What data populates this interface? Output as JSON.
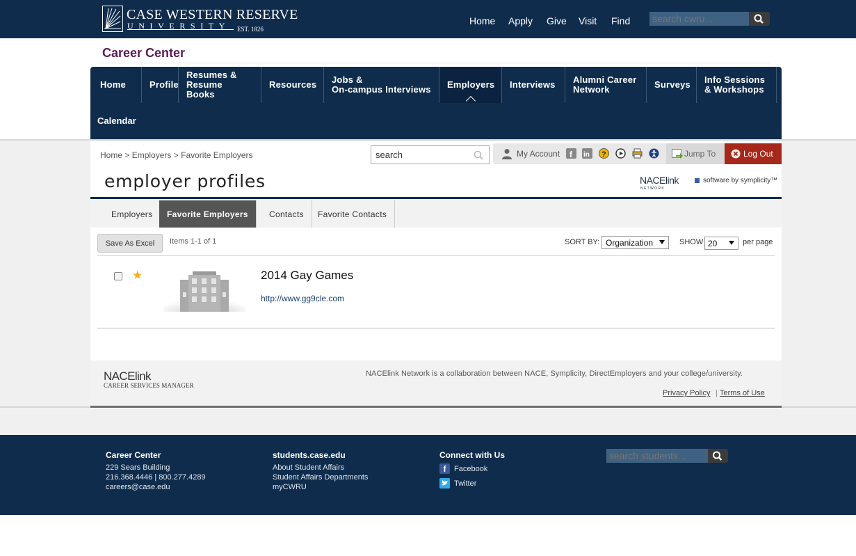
{
  "branding": {
    "university_line1": "CASE WESTERN RESERVE",
    "university_line2": "UNIVERSITY",
    "established": "EST. 1826"
  },
  "top_nav": {
    "items": [
      "Home",
      "Apply",
      "Give",
      "Visit",
      "Find"
    ],
    "search_placeholder": "search cwru..."
  },
  "site_title": "Career Center",
  "main_nav": {
    "items": [
      {
        "label": "Home"
      },
      {
        "label": "Profile"
      },
      {
        "label": "Resumes &\nResume Books"
      },
      {
        "label": "Resources"
      },
      {
        "label": "Jobs &\nOn-campus Interviews"
      },
      {
        "label": "Employers",
        "active": true
      },
      {
        "label": "Interviews"
      },
      {
        "label": "Alumni Career\nNetwork"
      },
      {
        "label": "Surveys"
      },
      {
        "label": "Info Sessions\n& Workshops"
      }
    ],
    "second_row": [
      "Calendar"
    ]
  },
  "breadcrumb": {
    "items": [
      "Home",
      "Employers",
      "Favorite Employers"
    ],
    "separator": ">"
  },
  "search": {
    "placeholder": "search"
  },
  "utility": {
    "my_account": "My Account",
    "jump_to": "Jump To",
    "log_out": "Log Out",
    "icons": [
      "facebook-icon",
      "linkedin-icon",
      "help-icon",
      "play-icon",
      "print-icon",
      "accessibility-icon"
    ]
  },
  "page_heading": "employer profiles",
  "partner": {
    "nace_logo_text": "NACElink",
    "nace_logo_subtext": "N E T W O R K",
    "software_by": "software by symplicity™"
  },
  "tabs": [
    {
      "label": "Employers"
    },
    {
      "label": "Favorite Employers",
      "active": true
    },
    {
      "label": "Contacts"
    },
    {
      "label": "Favorite Contacts"
    }
  ],
  "list_controls": {
    "save_button": "Save As Excel",
    "items_count": "Items 1-1 of 1",
    "sort_label": "SORT BY:",
    "sort_value": "Organization",
    "show_label": "SHOW",
    "show_value": "20",
    "per_page_label": "per page"
  },
  "employers": [
    {
      "name": "2014 Gay Games",
      "url": "http://www.gg9cle.com",
      "favorite": true,
      "checked": false
    }
  ],
  "content_footer": {
    "nace_logo_text": "NACElink",
    "csm_label": "CAREER SERVICES MANAGER",
    "collab_text": "NACElink Network is a collaboration between NACE, Symplicity, DirectEmployers and your college/university.",
    "privacy": "Privacy Policy",
    "separator": "|",
    "terms": "Terms of Use"
  },
  "site_footer": {
    "career_center": {
      "heading": "Career Center",
      "lines": [
        "229 Sears Building",
        "216.368.4446 | 800.277.4289",
        "careers@case.edu"
      ]
    },
    "students": {
      "heading": "students.case.edu",
      "links": [
        "About Student Affairs",
        "Student Affairs Departments",
        "myCWRU"
      ]
    },
    "connect": {
      "heading": "Connect with Us",
      "links": [
        "Facebook",
        "Twitter"
      ]
    },
    "search_placeholder": "search students..."
  },
  "colors": {
    "navy": "#0f2c4c",
    "career_title": "#5b1c5b",
    "logout_red": "#a5281b",
    "star": "#f2b21c",
    "active_tab": "#555555"
  }
}
